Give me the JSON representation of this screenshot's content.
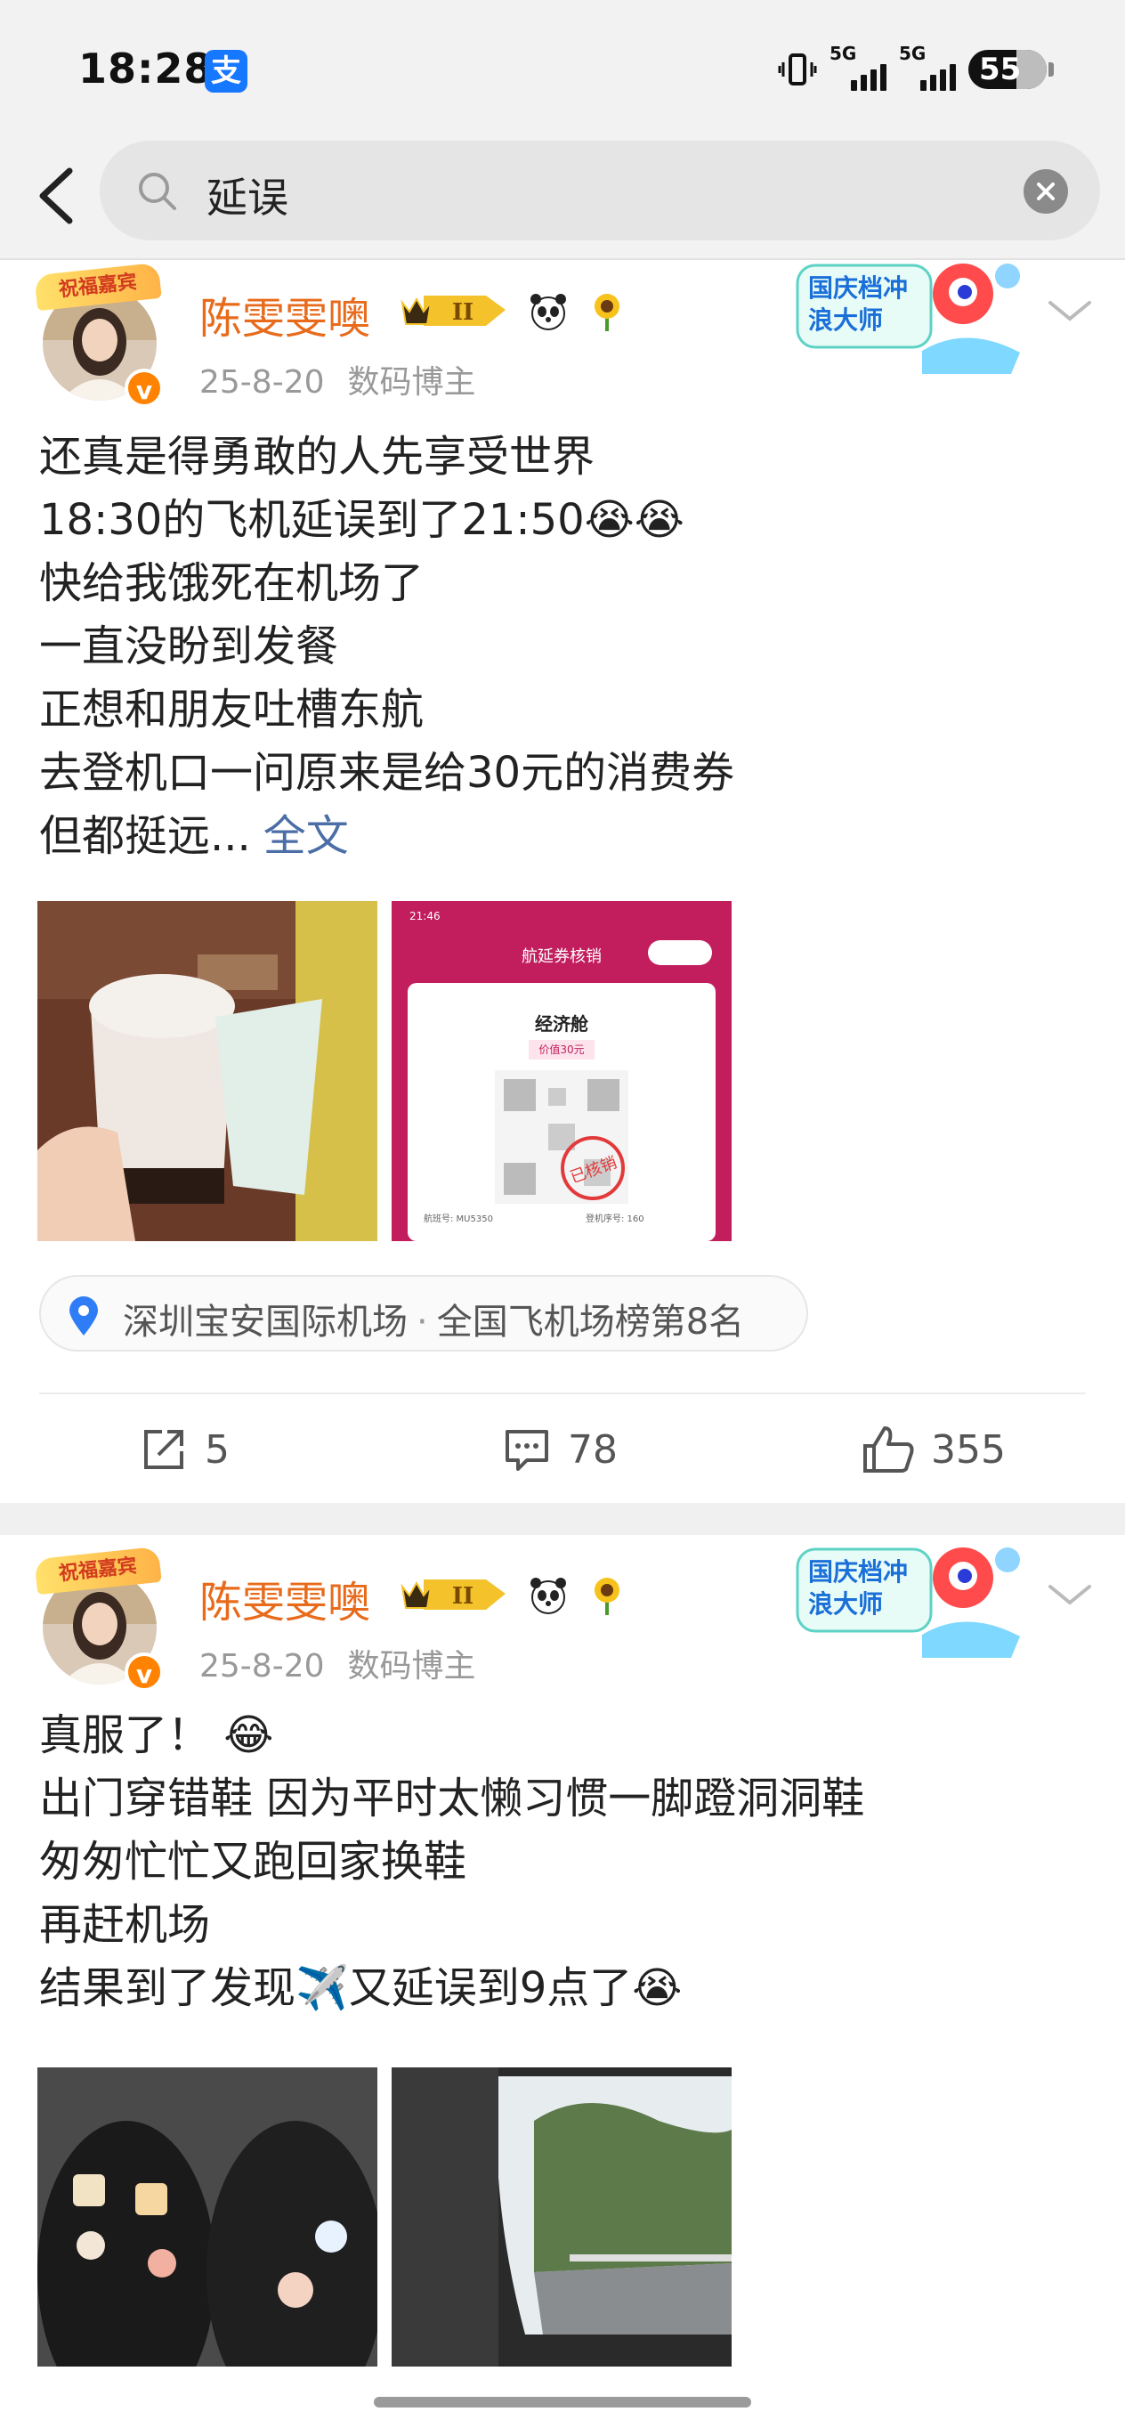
{
  "status_bar": {
    "time": "18:28",
    "app_badge": "支",
    "signal_1_label": "5G",
    "signal_2_label": "5G",
    "battery": "55"
  },
  "search": {
    "query": "延误"
  },
  "posts": [
    {
      "frame_tag": "祝福嘉宾",
      "username": "陈雯雯噢",
      "vip_level": "II",
      "date": "25-8-20",
      "tag": "数码博主",
      "sticker_text": "国庆档冲浪大师",
      "lines": [
        "还真是得勇敢的人先享受世界",
        "18:30的飞机延误到了21:50😭😭",
        "快给我饿死在机场了",
        "一直没盼到发餐",
        "正想和朋友吐槽东航",
        "去登机口一问原来是给30元的消费券",
        "但都挺远..."
      ],
      "more_label": "全文",
      "image2": {
        "status_time": "21:46",
        "title": "航延券核销",
        "cabin": "经济舱",
        "value": "价值30元",
        "stamp": "已核销",
        "flight": "航班号: MU5350",
        "seq": "登机序号: 160"
      },
      "location": {
        "name": "深圳宝安国际机场",
        "dot": "·",
        "rank": "全国飞机场榜第8名"
      },
      "actions": {
        "share": "5",
        "comment": "78",
        "like": "355"
      }
    },
    {
      "frame_tag": "祝福嘉宾",
      "username": "陈雯雯噢",
      "vip_level": "II",
      "date": "25-8-20",
      "tag": "数码博主",
      "sticker_text": "国庆档冲浪大师",
      "lines": [
        "真服了！ 😂",
        "出门穿错鞋 因为平时太懒习惯一脚蹬洞洞鞋",
        "匆匆忙忙又跑回家换鞋",
        "再赶机场",
        "结果到了发现✈️又延误到9点了😭"
      ]
    }
  ]
}
